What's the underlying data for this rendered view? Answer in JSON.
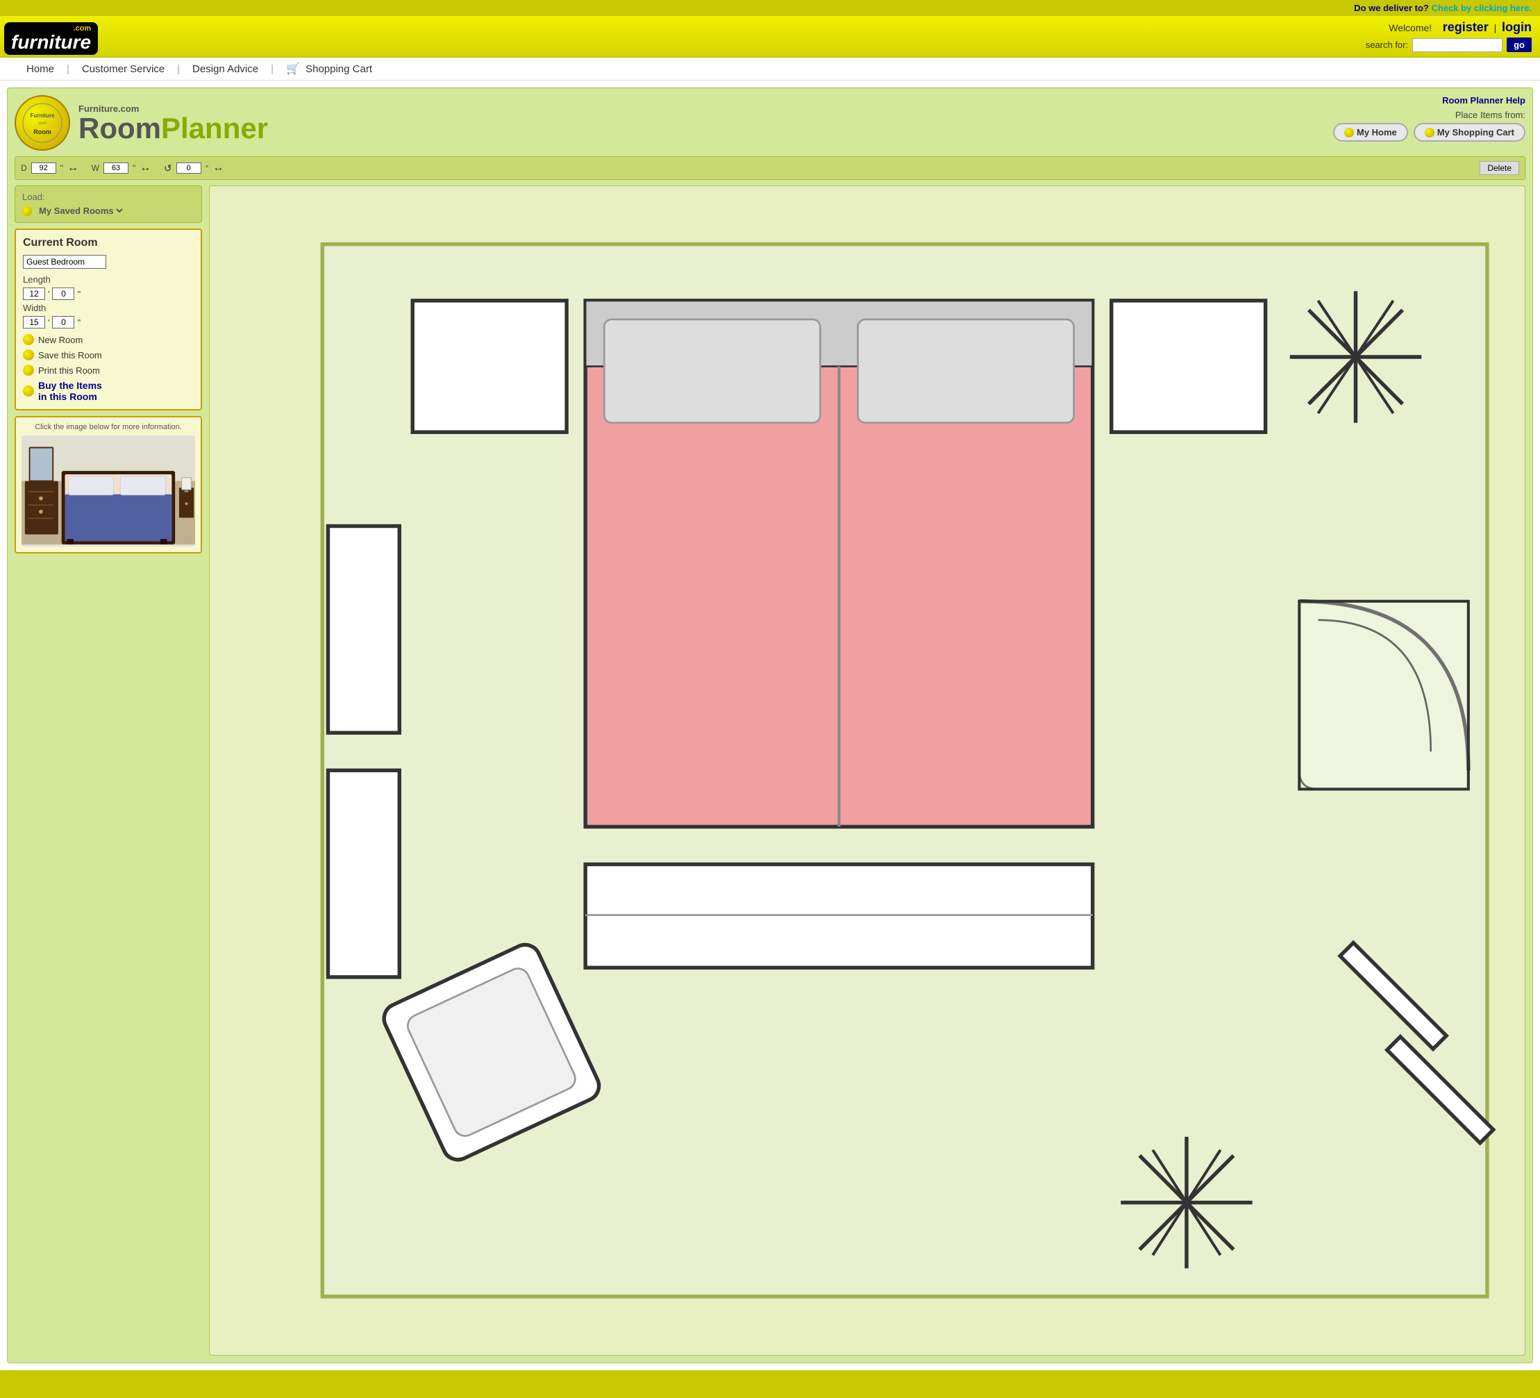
{
  "delivery_bar": {
    "question": "Do we deliver to?",
    "link_text": "Check by clicking here."
  },
  "header": {
    "logo": {
      "dot_com": ".com",
      "furniture": "furniture"
    },
    "welcome": "Welcome!",
    "register": "register",
    "pipe": "|",
    "login": "login",
    "search_label": "search for:",
    "search_placeholder": "",
    "go_button": "go"
  },
  "nav": {
    "items": [
      {
        "label": "Home",
        "id": "home"
      },
      {
        "label": "Customer Service",
        "id": "customer-service"
      },
      {
        "label": "Design Advice",
        "id": "design-advice"
      },
      {
        "label": "Shopping Cart",
        "id": "shopping-cart"
      }
    ]
  },
  "planner": {
    "help_link": "Room Planner Help",
    "furniture_com": "Furniture.com",
    "title_room": "Room",
    "title_planner": "Planner",
    "place_items_label": "Place Items from:",
    "my_home_btn": "My Home",
    "my_shopping_cart_btn": "My Shopping Cart",
    "controls": {
      "d_label": "D",
      "d_value": "92",
      "d_unit": "\"",
      "w_label": "W",
      "w_value": "63",
      "w_unit": "\"",
      "rotate_value": "0",
      "rotate_unit": "°",
      "delete_btn": "Delete"
    },
    "load": {
      "label": "Load:",
      "dropdown_value": "My Saved Rooms"
    },
    "current_room": {
      "title": "Current Room",
      "room_name": "Guest Bedroom",
      "length_label": "Length",
      "length_ft": "12",
      "length_in": "0",
      "length_unit": "\"",
      "width_label": "Width",
      "width_ft": "15",
      "width_in": "0",
      "width_unit": "\"",
      "actions": [
        {
          "id": "new-room",
          "label": "New Room"
        },
        {
          "id": "save-room",
          "label": "Save this Room"
        },
        {
          "id": "print-room",
          "label": "Print this Room"
        },
        {
          "id": "buy-items",
          "label": "Buy the Items\nin this Room",
          "is_link": true
        }
      ]
    },
    "product_panel": {
      "hint": "Click the image below for more information."
    }
  }
}
